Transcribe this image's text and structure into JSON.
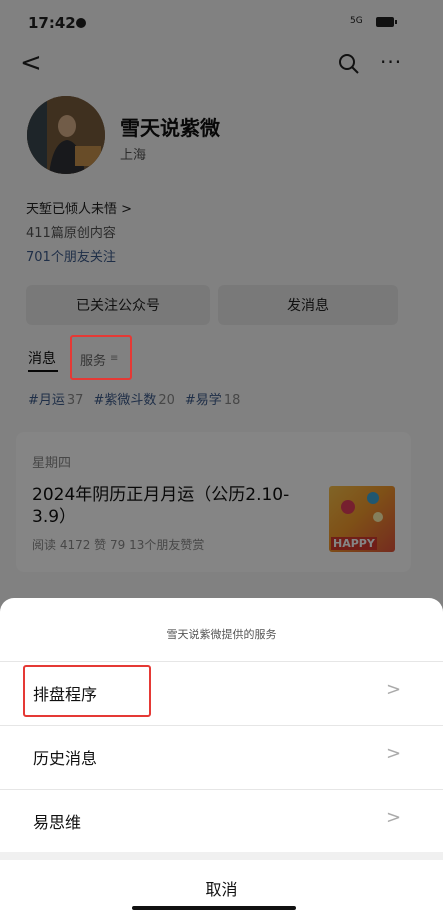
{
  "status_bar": {
    "time": "17:42",
    "network": "5G"
  },
  "profile": {
    "name": "雪天说紫微",
    "location": "上海",
    "signature": "天堑已倾人未悟 >",
    "articles": "411篇原创内容",
    "friends_following": "701个朋友关注"
  },
  "actions": {
    "followed": "已关注公众号",
    "message": "发消息"
  },
  "tabs": {
    "messages": "消息",
    "services": "服务",
    "services_icon": "≡"
  },
  "tags": [
    {
      "label": "#月运",
      "count": "37"
    },
    {
      "label": "#紫微斗数",
      "count": "20"
    },
    {
      "label": "#易学",
      "count": "18"
    }
  ],
  "article": {
    "day": "星期四",
    "title": "2024年阴历正月月运（公历2.10-3.9）",
    "meta": "阅读 4172  赞 79  13个朋友赞赏",
    "thumb_text": "HAPPY"
  },
  "sheet": {
    "title": "雪天说紫微提供的服务",
    "items": [
      "排盘程序",
      "历史消息",
      "易思维"
    ],
    "cancel": "取消"
  },
  "icons": {
    "chevron": ">",
    "back": "<",
    "more": "···"
  },
  "colors": {
    "link": "#3d5a8a",
    "highlight": "#e53935"
  }
}
